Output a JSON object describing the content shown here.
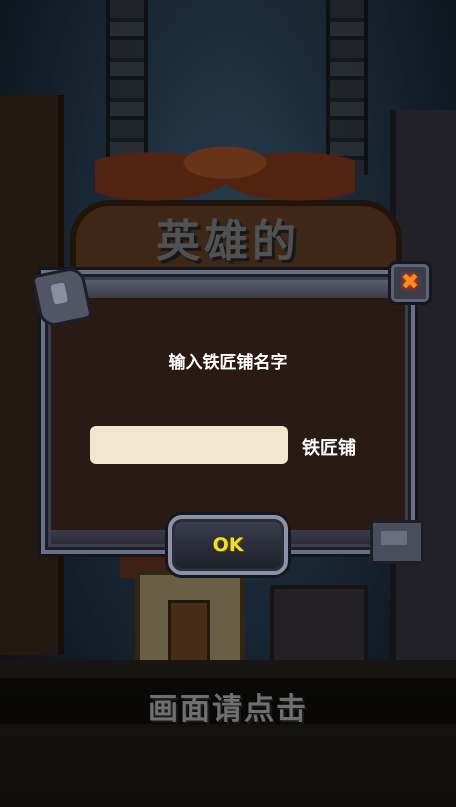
{
  "background": {
    "sign_title": "英雄的",
    "tap_prompt": "画面请点击"
  },
  "dialog": {
    "title": "输入铁匠铺名字",
    "name_input": {
      "value": "",
      "placeholder": ""
    },
    "name_suffix": "铁匠铺",
    "ok_label": "OK",
    "close_icon": "close-x-icon"
  },
  "colors": {
    "ok_text": "#f2e21a",
    "input_bg": "#f1e7d0",
    "dialog_bg": "#2a1a15",
    "close_x": "#ff8a1e"
  }
}
